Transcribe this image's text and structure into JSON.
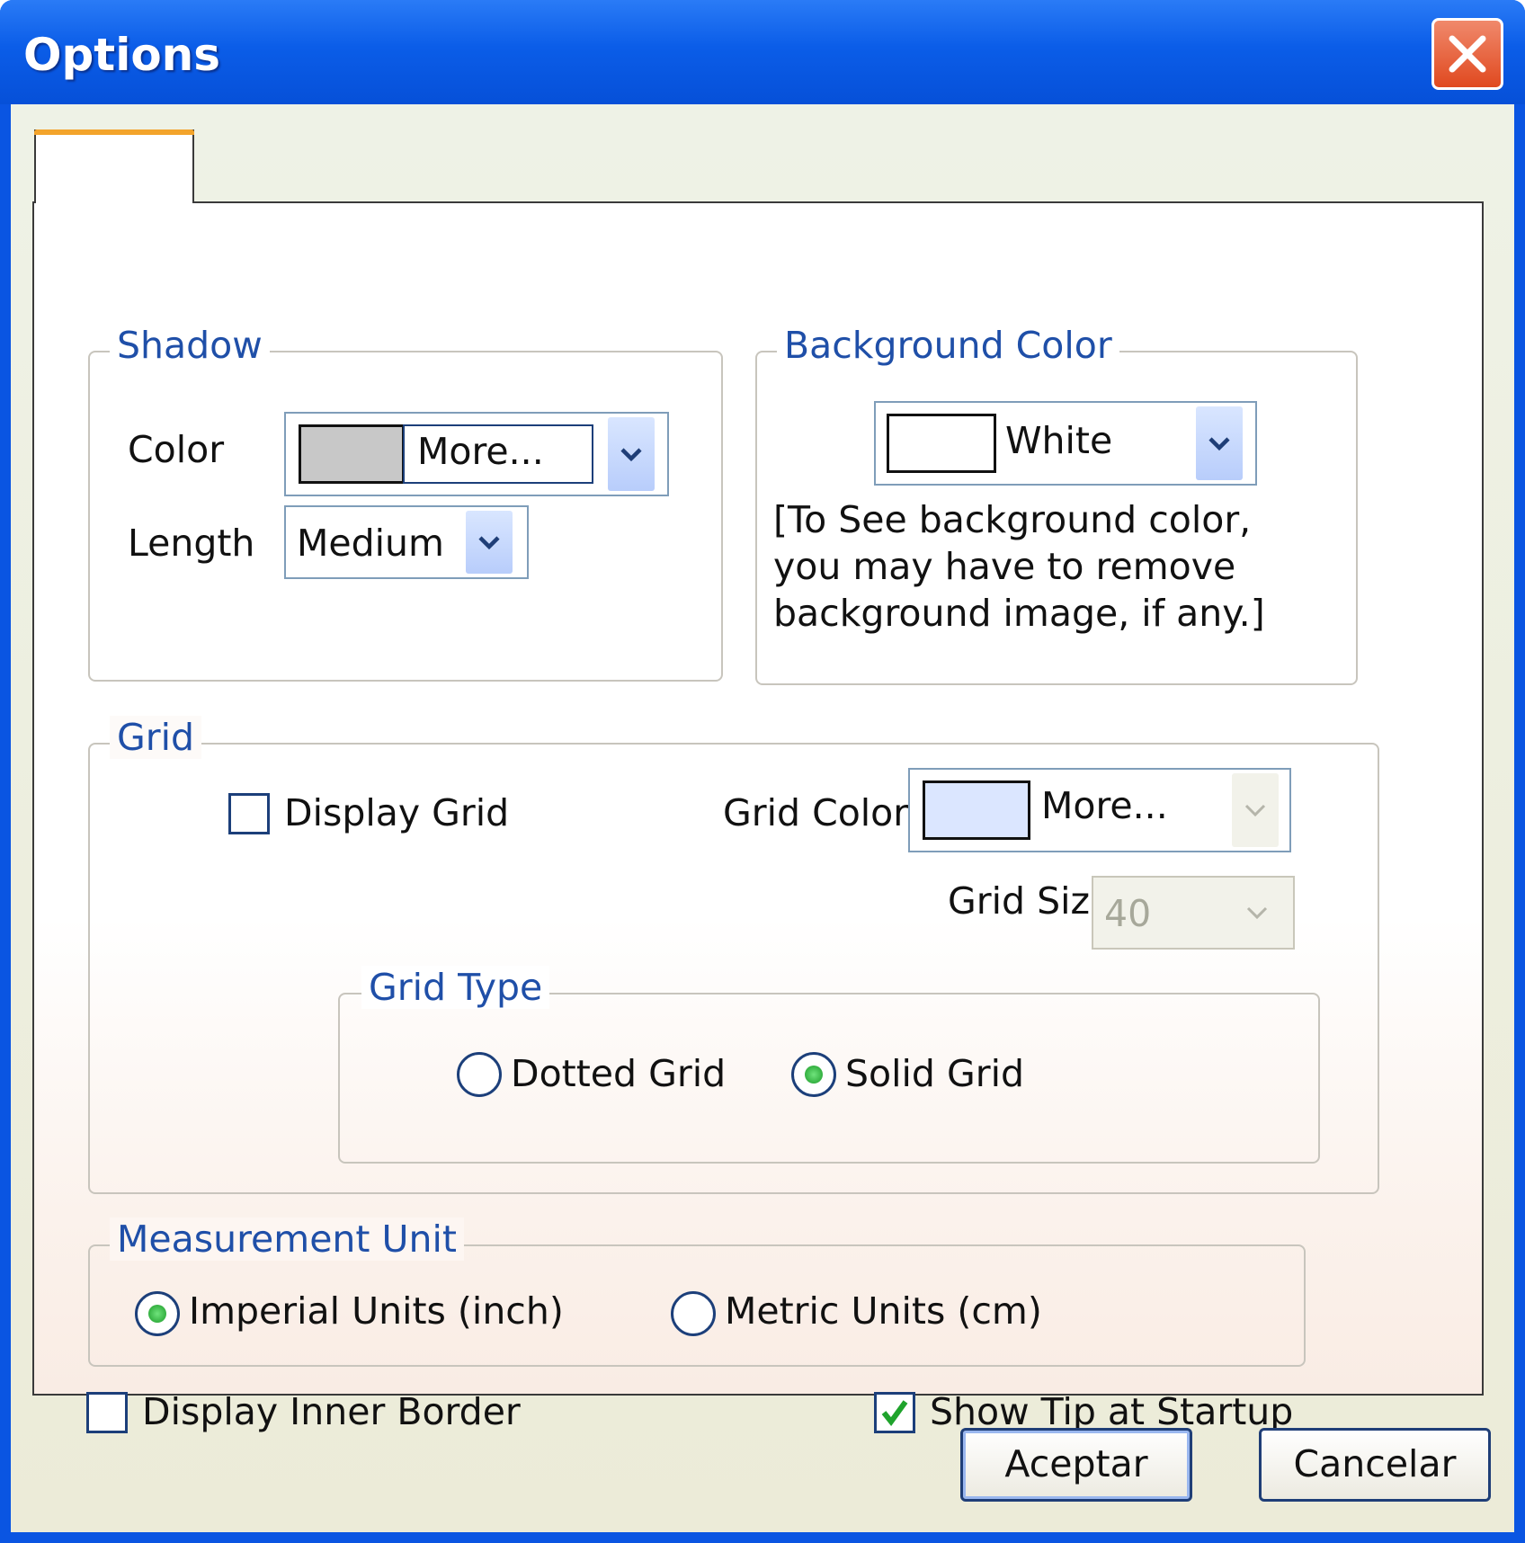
{
  "window": {
    "title": "Options"
  },
  "shadow": {
    "legend": "Shadow",
    "color_label": "Color",
    "color_value": "More...",
    "color_swatch": "#c8c8c8",
    "length_label": "Length",
    "length_value": "Medium"
  },
  "background": {
    "legend": "Background Color",
    "color_value": "White",
    "color_swatch": "#ffffff",
    "note": "[To See background color, you may have to remove background image, if any.]"
  },
  "grid": {
    "legend": "Grid",
    "display_grid_label": "Display Grid",
    "display_grid_checked": false,
    "grid_color_label": "Grid Color",
    "grid_color_value": "More...",
    "grid_color_swatch": "#dbe6ff",
    "grid_size_label": "Grid Size",
    "grid_size_value": "40",
    "grid_type": {
      "legend": "Grid Type",
      "dotted_label": "Dotted Grid",
      "solid_label": "Solid Grid",
      "selected": "Solid Grid"
    }
  },
  "measurement": {
    "legend": "Measurement Unit",
    "imperial_label": "Imperial Units (inch)",
    "metric_label": "Metric Units (cm)",
    "selected": "Imperial Units (inch)"
  },
  "display_inner_border": {
    "label": "Display Inner Border",
    "checked": false
  },
  "show_tip": {
    "label": "Show Tip at Startup",
    "checked": true
  },
  "buttons": {
    "ok": "Aceptar",
    "cancel": "Cancelar"
  },
  "colors": {
    "accent": "#0a55e2",
    "legend_text": "#1f4fa8",
    "tab_highlight": "#f3a42b"
  }
}
